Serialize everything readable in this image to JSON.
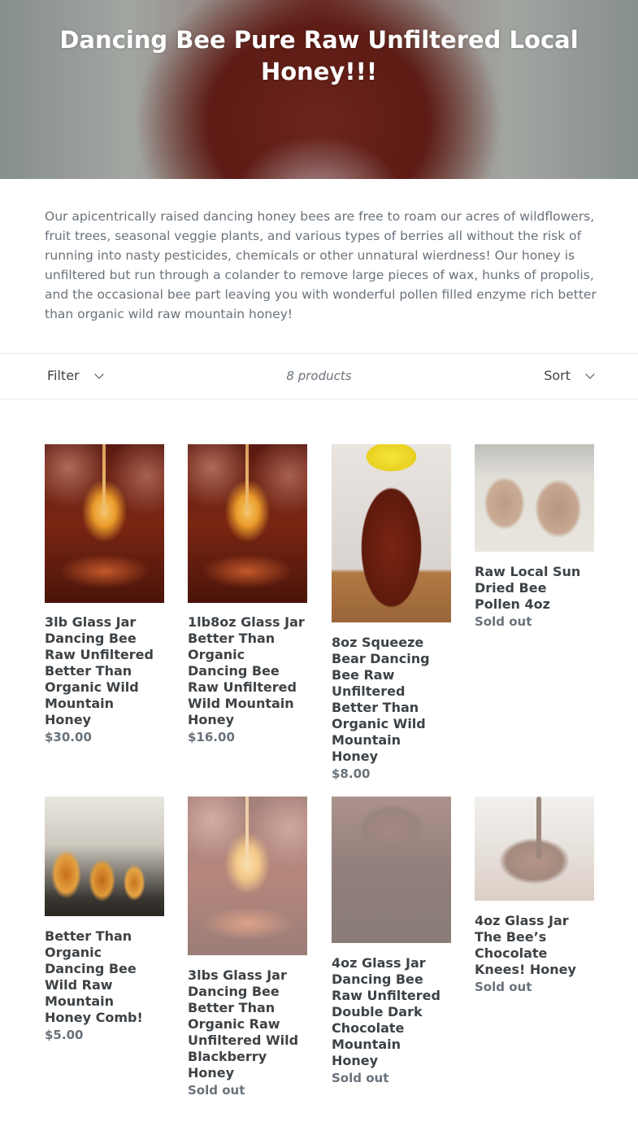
{
  "hero": {
    "title": "Dancing Bee Pure Raw Unfiltered Local Honey!!!"
  },
  "description": "Our apicentrically raised dancing honey bees are free to roam our acres of wildflowers, fruit trees, seasonal veggie plants, and various types of berries all without the risk of running into nasty pesticides, chemicals or other unnatural wierdness! Our honey is unfiltered but run through a colander to remove large pieces of wax, hunks of propolis, and the occasional bee part leaving you with wonderful pollen filled enzyme rich better than organic wild raw mountain honey!",
  "toolbar": {
    "filter_label": "Filter",
    "product_count": "8 products",
    "sort_label": "Sort"
  },
  "products": [
    {
      "title": "3lb Glass Jar Dancing Bee Raw Unfiltered Better Than Organic Wild Mountain Honey",
      "price": "$30.00",
      "image": "honey-dipper-photo"
    },
    {
      "title": "1lb8oz Glass Jar Better Than Organic Dancing Bee Raw Unfiltered Wild Mountain Honey",
      "price": "$16.00",
      "image": "honey-dipper-photo"
    },
    {
      "title": "8oz Squeeze Bear Dancing Bee Raw Unfiltered Better Than Organic Wild Mountain Honey",
      "price": "$8.00",
      "image": "honey-bear-bottle-photo"
    },
    {
      "title": "Raw Local Sun Dried Bee Pollen 4oz",
      "price": "Sold out",
      "image": "bee-pollen-jars-photo"
    },
    {
      "title": "Better Than Organic Dancing Bee Wild Raw Mountain Honey Comb!",
      "price": "$5.00",
      "image": "honey-comb-cups-photo"
    },
    {
      "title": "3lbs Glass Jar Dancing Bee Better Than Organic Raw Unfiltered Wild Blackberry Honey",
      "price": "Sold out",
      "image": "honey-dipper-photo"
    },
    {
      "title": "4oz Glass Jar Dancing Bee Raw Unfiltered Double Dark Chocolate Mountain Honey",
      "price": "Sold out",
      "image": "dark-honey-jar-photo"
    },
    {
      "title": "4oz Glass Jar The Bee’s Chocolate Knees! Honey",
      "price": "Sold out",
      "image": "chocolate-honey-jar-photo"
    }
  ]
}
